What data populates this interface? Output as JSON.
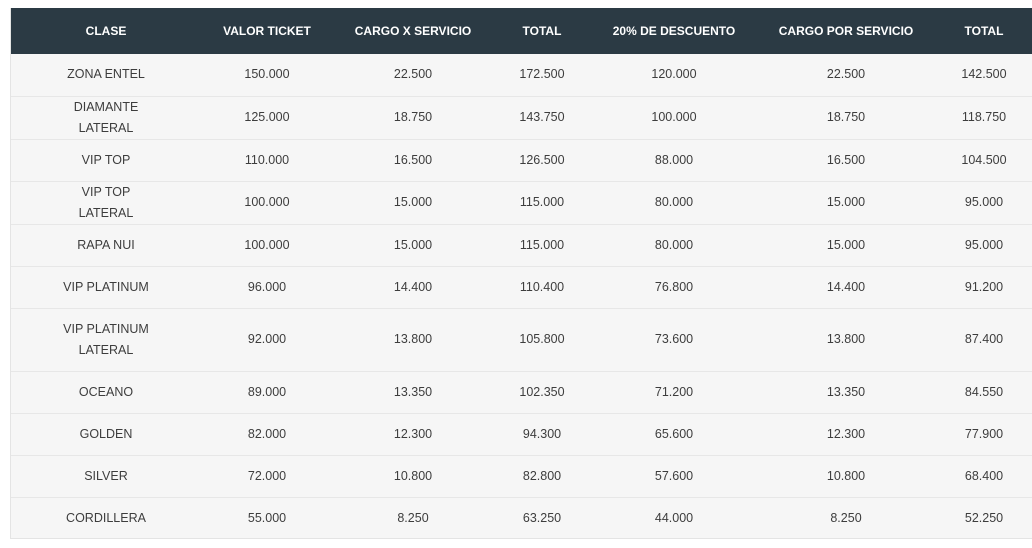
{
  "table": {
    "headers": [
      "CLASE",
      "VALOR TICKET",
      "CARGO X SERVICIO",
      "TOTAL",
      "20% DE DESCUENTO",
      "CARGO POR SERVICIO",
      "TOTAL"
    ],
    "rows": [
      [
        "ZONA ENTEL",
        "150.000",
        "22.500",
        "172.500",
        "120.000",
        "22.500",
        "142.500"
      ],
      [
        "DIAMANTE LATERAL",
        "125.000",
        "18.750",
        "143.750",
        "100.000",
        "18.750",
        "118.750"
      ],
      [
        "VIP TOP",
        "110.000",
        "16.500",
        "126.500",
        "88.000",
        "16.500",
        "104.500"
      ],
      [
        "VIP TOP LATERAL",
        "100.000",
        "15.000",
        "115.000",
        "80.000",
        "15.000",
        "95.000"
      ],
      [
        "RAPA NUI",
        "100.000",
        "15.000",
        "115.000",
        "80.000",
        "15.000",
        "95.000"
      ],
      [
        "VIP PLATINUM",
        "96.000",
        "14.400",
        "110.400",
        "76.800",
        "14.400",
        "91.200"
      ],
      [
        "VIP PLATINUM LATERAL",
        "92.000",
        "13.800",
        "105.800",
        "73.600",
        "13.800",
        "87.400"
      ],
      [
        "OCEANO",
        "89.000",
        "13.350",
        "102.350",
        "71.200",
        "13.350",
        "84.550"
      ],
      [
        "GOLDEN",
        "82.000",
        "12.300",
        "94.300",
        "65.600",
        "12.300",
        "77.900"
      ],
      [
        "SILVER",
        "72.000",
        "10.800",
        "82.800",
        "57.600",
        "10.800",
        "68.400"
      ],
      [
        "CORDILLERA",
        "55.000",
        "8.250",
        "63.250",
        "44.000",
        "8.250",
        "52.250"
      ]
    ]
  },
  "colors": {
    "header_background": "#2b3a44",
    "header_text": "#ffffff",
    "body_background": "#f6f6f6",
    "body_text": "#3d3d3d",
    "row_divider": "#e7e7e7"
  }
}
